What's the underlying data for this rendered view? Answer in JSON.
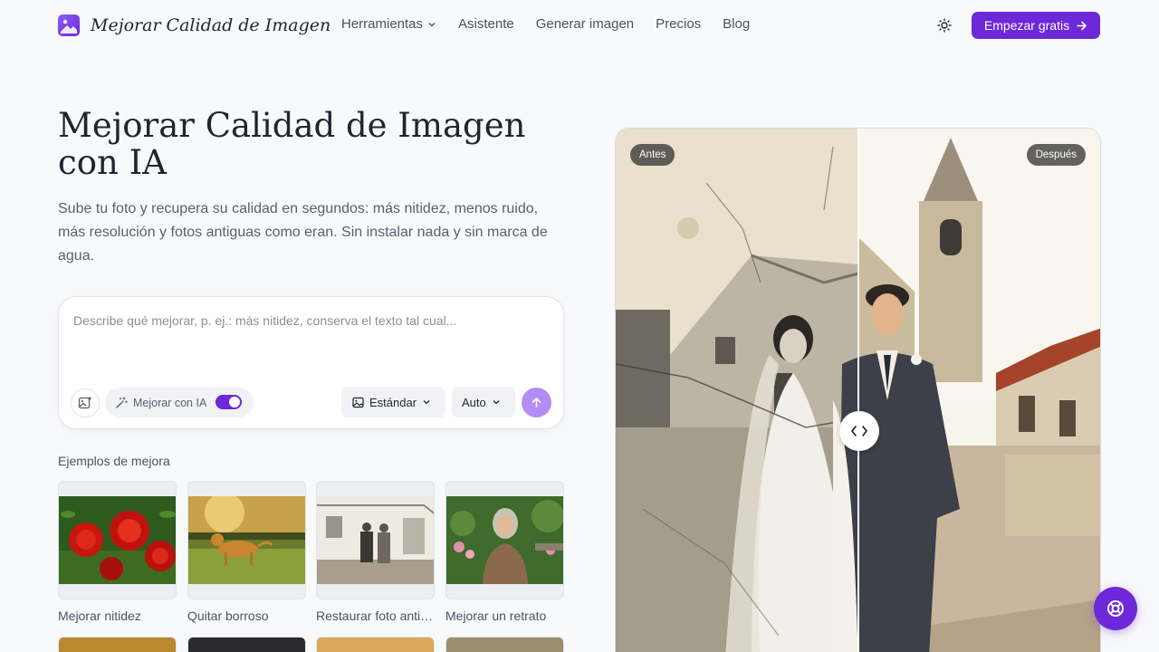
{
  "brand": {
    "name": "Mejorar Calidad de Imagen",
    "accent": "#6d28d9"
  },
  "nav": {
    "items": [
      {
        "label": "Herramientas",
        "dropdown": true
      },
      {
        "label": "Asistente"
      },
      {
        "label": "Generar imagen"
      },
      {
        "label": "Precios"
      },
      {
        "label": "Blog"
      }
    ],
    "theme_icon": "sun-icon",
    "cta_label": "Empezar gratis"
  },
  "hero": {
    "title": "Mejorar Calidad de Imagen con IA",
    "subtitle": "Sube tu foto y recupera su calidad en segundos: más nitidez, menos ruido, más resolución y fotos antiguas como eran. Sin instalar nada y sin marca de agua."
  },
  "prompt": {
    "placeholder": "Describe qué mejorar, p. ej.: más nitidez, conserva el texto tal cual...",
    "ai_toggle_label": "Mejorar con IA",
    "ai_toggle_on": true,
    "quality_label": "Estándar",
    "size_label": "Auto"
  },
  "examples": {
    "title": "Ejemplos de mejora",
    "items": [
      {
        "label": "Mejorar nitidez",
        "icon": "roses-thumbnail"
      },
      {
        "label": "Quitar borroso",
        "icon": "dog-thumbnail"
      },
      {
        "label": "Restaurar foto antigua",
        "icon": "old-couple-thumbnail"
      },
      {
        "label": "Mejorar un retrato",
        "icon": "portrait-thumbnail"
      }
    ]
  },
  "comparison": {
    "before_label": "Antes",
    "after_label": "Después"
  }
}
